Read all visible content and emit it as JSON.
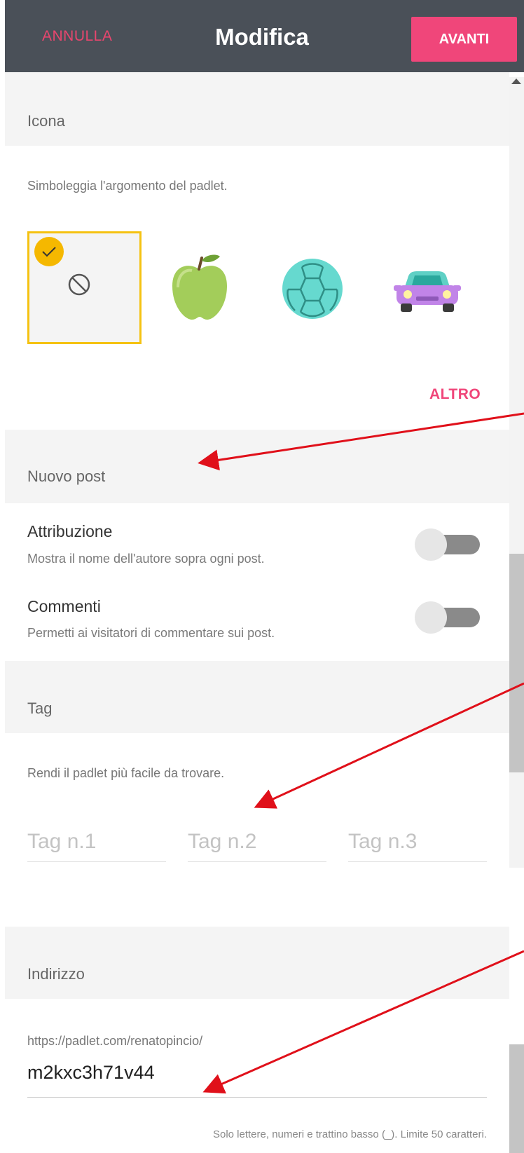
{
  "header": {
    "cancel_label": "ANNULLA",
    "title": "Modifica",
    "next_label": "AVANTI"
  },
  "icon_section": {
    "label": "Icona",
    "description": "Simboleggia l'argomento del padlet.",
    "options": [
      {
        "name": "no-icon",
        "selected": true
      },
      {
        "name": "apple-icon",
        "selected": false
      },
      {
        "name": "ball-icon",
        "selected": false
      },
      {
        "name": "car-icon",
        "selected": false
      }
    ],
    "more_label": "ALTRO"
  },
  "new_post_section": {
    "label": "Nuovo post",
    "items": [
      {
        "title": "Attribuzione",
        "subtitle": "Mostra il nome dell'autore sopra ogni post."
      },
      {
        "title": "Commenti",
        "subtitle": "Permetti ai visitatori di commentare sui post."
      }
    ]
  },
  "tag_section": {
    "label": "Tag",
    "description": "Rendi il padlet più facile da trovare.",
    "placeholders": [
      "Tag n.1",
      "Tag n.2",
      "Tag n.3"
    ]
  },
  "address_section": {
    "label": "Indirizzo",
    "prefix": "https://padlet.com/renatopincio/",
    "value": "m2kxc3h71v44",
    "hint": "Solo lettere, numeri e trattino basso (_). Limite 50 caratteri."
  },
  "colors": {
    "header_bg": "#4a5058",
    "accent": "#f0467a",
    "selected_border": "#f5c211",
    "annotation_arrow": "#e0101a"
  }
}
